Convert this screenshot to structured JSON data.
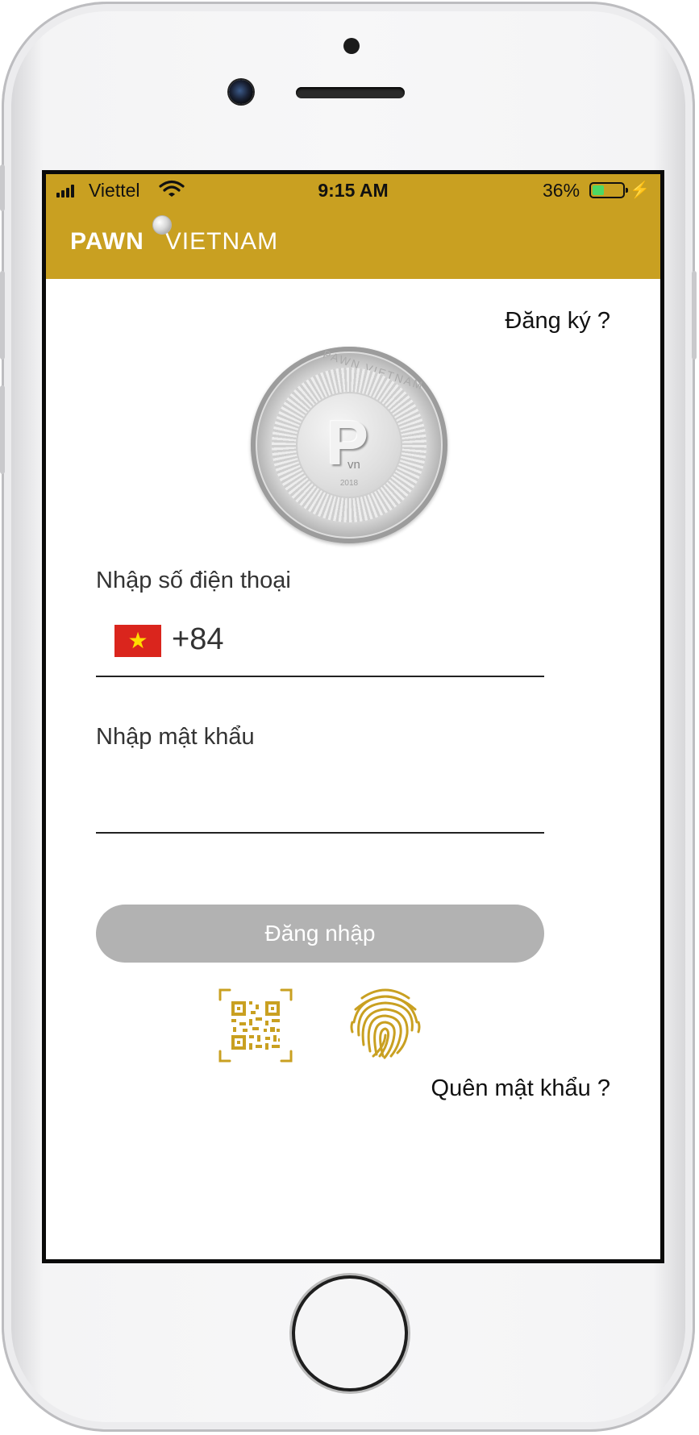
{
  "status_bar": {
    "carrier": "Viettel",
    "time": "9:15 AM",
    "battery_percent": "36%",
    "battery_level": 0.36,
    "battery_color": "#4cd964"
  },
  "app_bar": {
    "logo_bold": "PAWN",
    "logo_light": "VIETNAM",
    "background_color": "#c9a021"
  },
  "register_link": "Đăng ký ?",
  "coin": {
    "ring_text": "PAWN VIETNAM",
    "letter": "P",
    "sub": "vn",
    "year": "2018"
  },
  "phone_field": {
    "label": "Nhập số điện thoại",
    "country_flag": "vietnam-flag",
    "country_code": "+84",
    "value": ""
  },
  "password_field": {
    "label": "Nhập mật khẩu",
    "value": ""
  },
  "login_button": "Đăng nhập",
  "icons": {
    "qr": "qr-code-icon",
    "fingerprint": "fingerprint-icon",
    "accent_color": "#c9a021"
  },
  "forgot_password_link": "Quên mật khẩu ?"
}
